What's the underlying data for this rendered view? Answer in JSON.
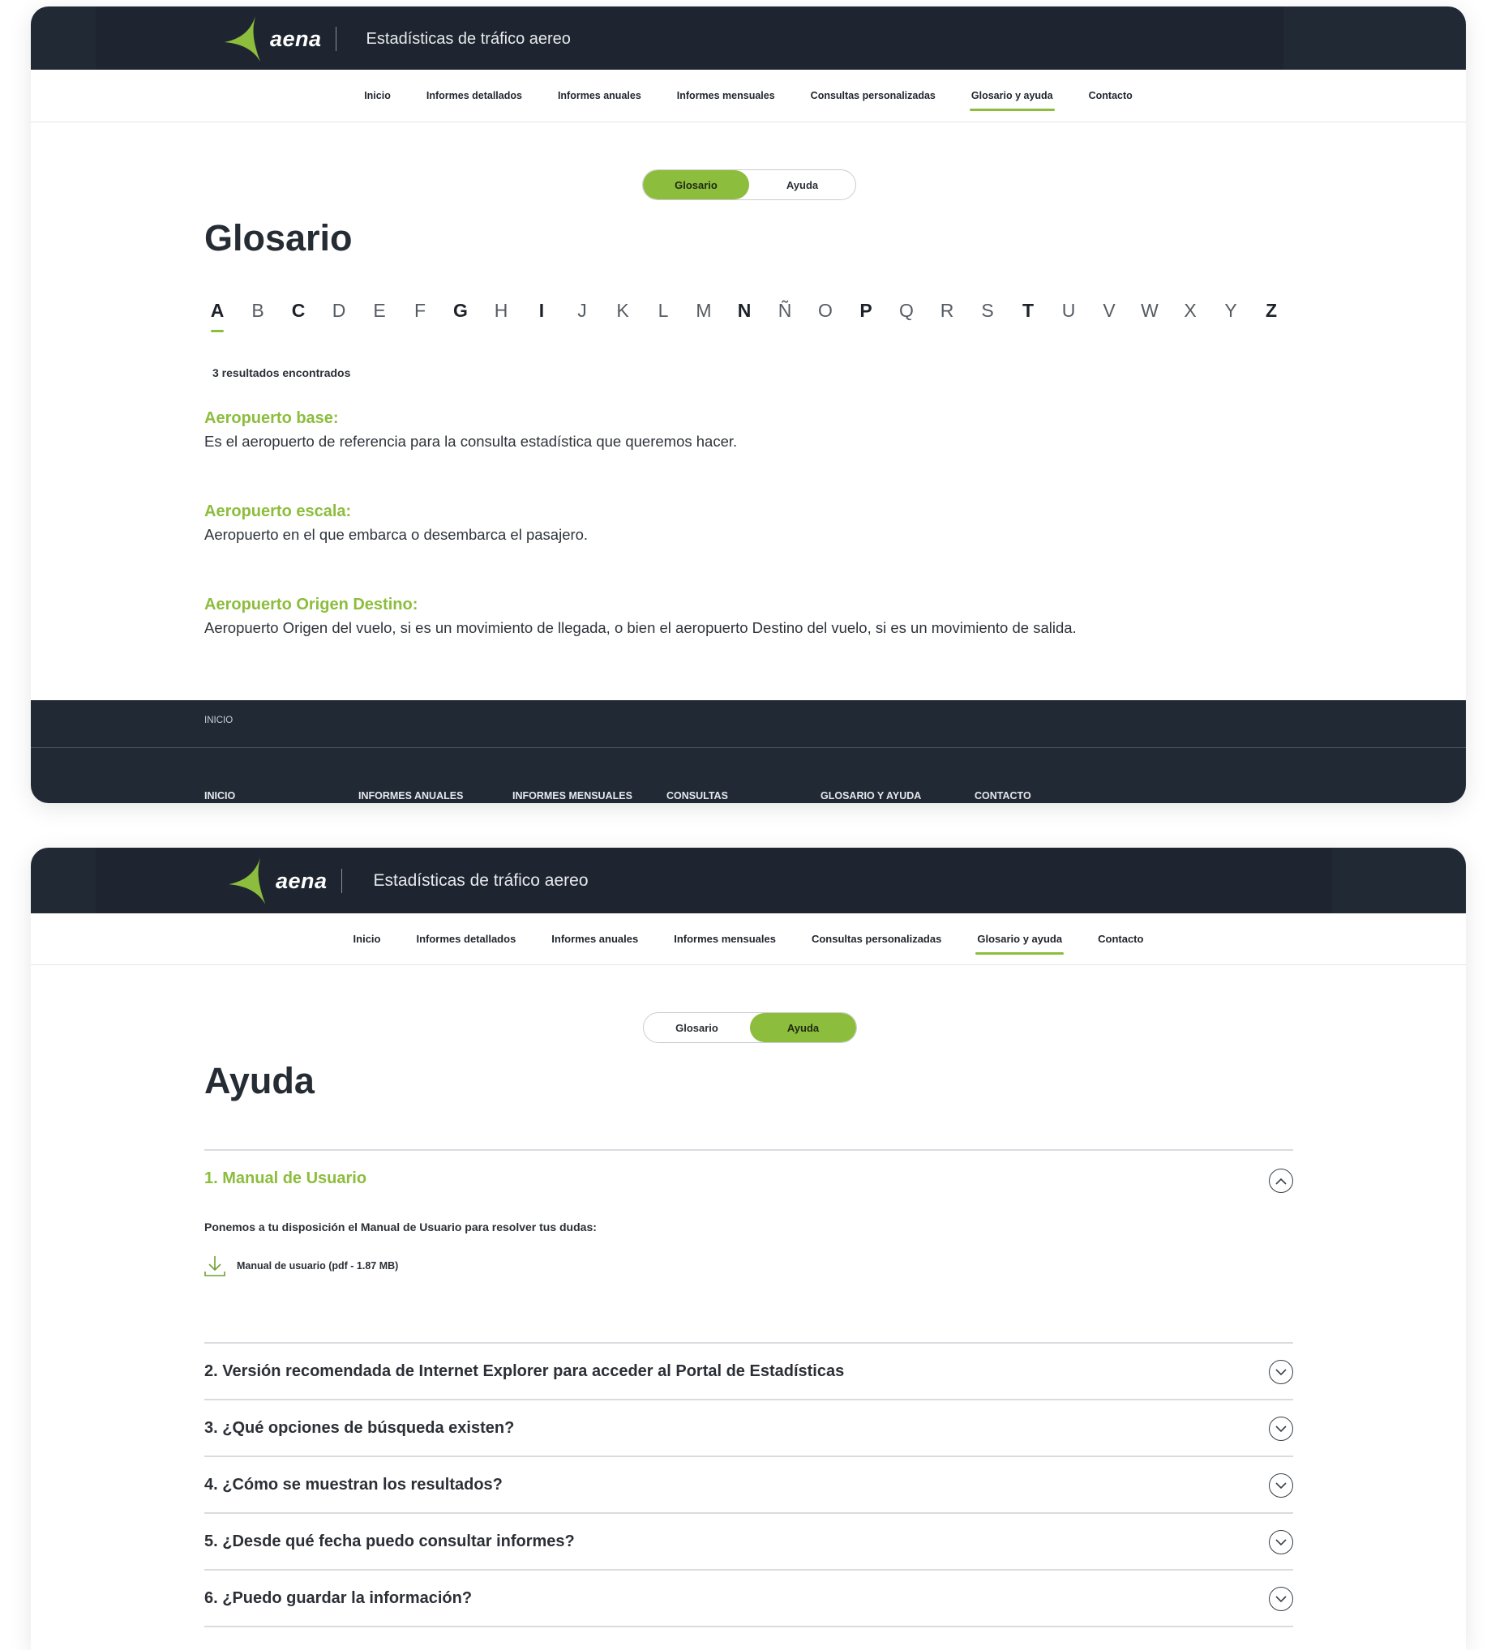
{
  "header": {
    "logo_text": "aena",
    "app_title": "Estadísticas de tráfico aereo",
    "brand_color": "#8cbd3c",
    "dark_color": "#212935"
  },
  "nav": {
    "items": [
      "Inicio",
      "Informes detallados",
      "Informes anuales",
      "Informes mensuales",
      "Consultas personalizadas",
      "Glosario y ayuda",
      "Contacto"
    ],
    "active": "Glosario y ayuda"
  },
  "toggle": {
    "glosario": "Glosario",
    "ayuda": "Ayuda"
  },
  "glossary": {
    "title": "Glosario",
    "letters": [
      "A",
      "B",
      "C",
      "D",
      "E",
      "F",
      "G",
      "H",
      "I",
      "J",
      "K",
      "L",
      "M",
      "N",
      "Ñ",
      "O",
      "P",
      "Q",
      "R",
      "S",
      "T",
      "U",
      "V",
      "W",
      "X",
      "Y",
      "Z"
    ],
    "bold_letters": [
      "A",
      "C",
      "G",
      "I",
      "N",
      "P",
      "T",
      "Z"
    ],
    "selected_letter": "A",
    "results": "3  resultados encontrados",
    "terms": [
      {
        "name": "Aeropuerto base:",
        "definition": "Es el aeropuerto de referencia para la consulta estadística que queremos hacer."
      },
      {
        "name": "Aeropuerto escala:",
        "definition": "Aeropuerto en el que embarca o desembarca el pasajero."
      },
      {
        "name": "Aeropuerto Origen Destino:",
        "definition": "Aeropuerto Origen del vuelo, si es un movimiento de llegada, o bien el aeropuerto Destino del vuelo, si es un movimiento de salida."
      }
    ]
  },
  "footer": {
    "breadcrumb": "INICIO",
    "links": [
      "INICIO",
      "INFORMES ANUALES",
      "INFORMES MENSUALES",
      "CONSULTAS PERSONALIZADAS",
      "GLOSARIO Y AYUDA",
      "CONTACTO"
    ]
  },
  "help": {
    "title": "Ayuda",
    "faq": [
      {
        "q": "1. Manual de Usuario",
        "open": true
      },
      {
        "q": "2. Versión recomendada de Internet Explorer para acceder al Portal de Estadísticas"
      },
      {
        "q": "3. ¿Qué opciones de búsqueda existen?"
      },
      {
        "q": "4. ¿Cómo se muestran los resultados?"
      },
      {
        "q": "5. ¿Desde qué fecha puedo consultar informes?"
      },
      {
        "q": "6. ¿Puedo guardar la información?"
      }
    ],
    "manual_intro": "Ponemos a tu disposición el Manual de Usuario para resolver tus dudas:",
    "manual_file": "Manual de usuario (pdf - 1.87 MB)"
  }
}
